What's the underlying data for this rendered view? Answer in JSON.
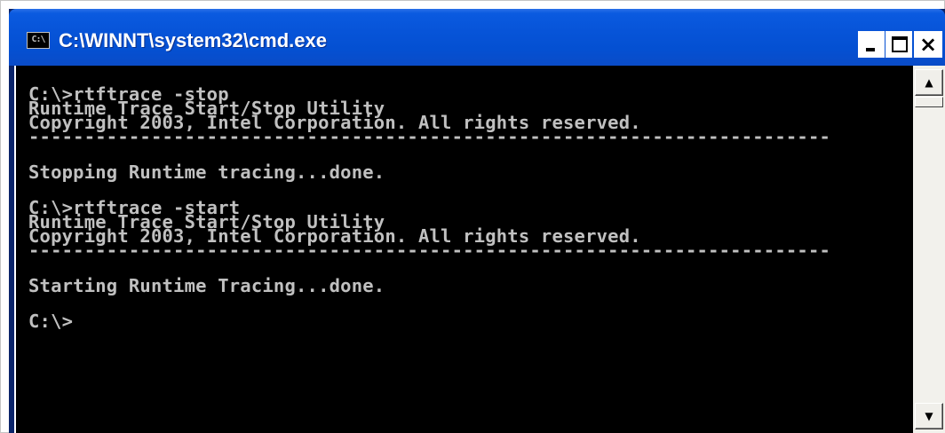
{
  "window": {
    "title": "C:\\WINNT\\system32\\cmd.exe",
    "icon_text": "C:\\",
    "icon": "console-app-icon",
    "controls": {
      "minimize": "minimize-icon",
      "maximize": "maximize-icon",
      "close": "close-icon",
      "close_glyph": "×"
    }
  },
  "console": {
    "lines": [
      "C:\\>rtftrace -stop",
      "Runtime Trace Start/Stop Utility",
      "Copyright 2003, Intel Corporation. All rights reserved.",
      "------------------------------------------------------------------------",
      "Stopping Runtime tracing...done.",
      "C:\\>rtftrace -start",
      "Runtime Trace Start/Stop Utility",
      "Copyright 2003, Intel Corporation. All rights reserved.",
      "------------------------------------------------------------------------",
      "Starting Runtime Tracing...done.",
      "C:\\>"
    ],
    "colors": {
      "background": "#000000",
      "text": "#c0c0c0"
    }
  },
  "scrollbar": {
    "up_glyph": "▲",
    "down_glyph": "▼"
  },
  "colors": {
    "titlebar": "#0754d8",
    "title_text": "#ffffff"
  }
}
